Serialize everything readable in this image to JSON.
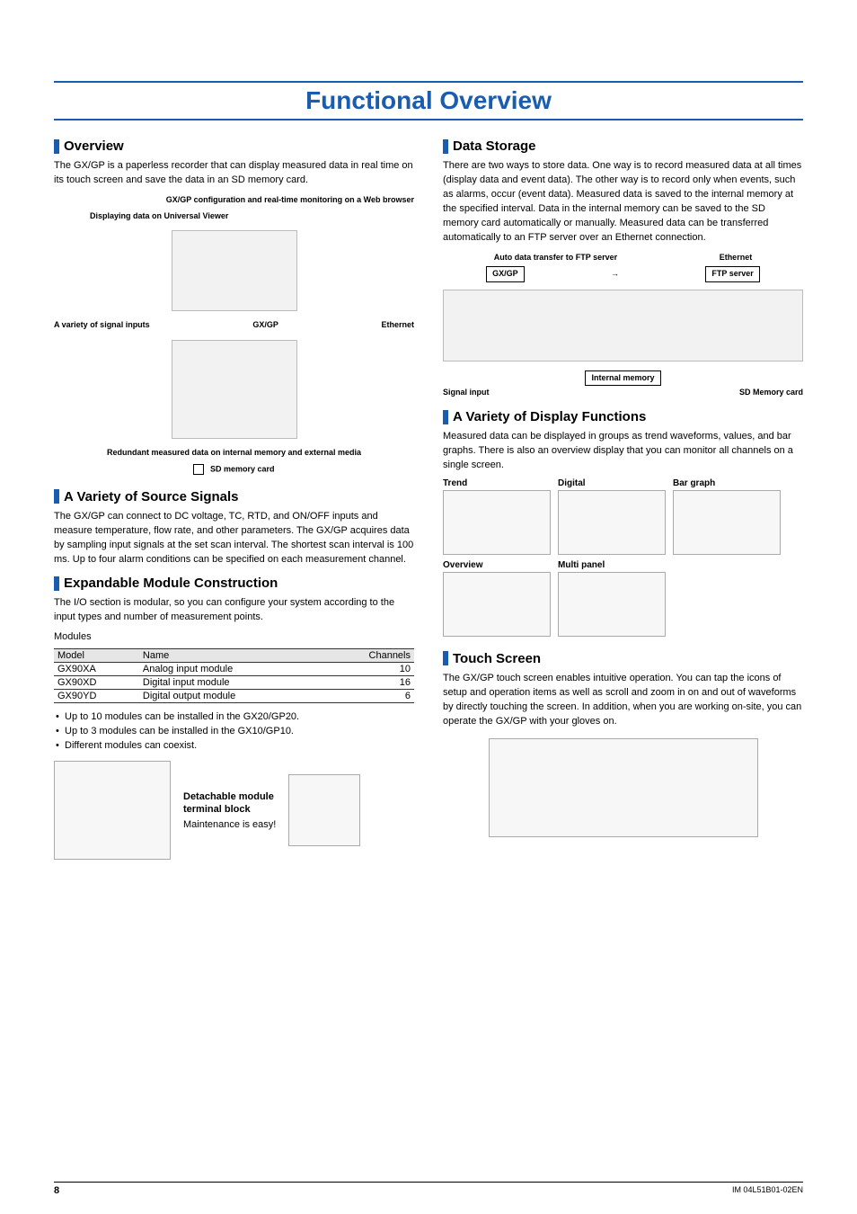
{
  "page_title": "Functional Overview",
  "left": {
    "overview": {
      "heading": "Overview",
      "text": "The GX/GP is a paperless recorder that can display measured data in real time on its touch screen and save the data in an SD memory card."
    },
    "overview_diagram": {
      "callout_config": "GX/GP configuration and real-time monitoring on a Web browser",
      "callout_viewer": "Displaying data on Universal Viewer",
      "label_ethernet": "Ethernet",
      "label_gxgp": "GX/GP",
      "callout_signals": "A variety of signal inputs",
      "callout_redundant": "Redundant measured data on internal memory and external media",
      "label_sd": "SD memory card"
    },
    "signals": {
      "heading": "A Variety of Source Signals",
      "text": "The GX/GP can connect to DC voltage, TC, RTD, and ON/OFF inputs and measure temperature, flow rate, and other parameters. The GX/GP acquires data by sampling input signals at the set scan interval. The shortest scan interval is 100 ms. Up to four alarm conditions can be specified on each measurement channel."
    },
    "modules": {
      "heading": "Expandable Module Construction",
      "text": "The I/O section is modular, so you can configure your system according to the input types and number of measurement points.",
      "table_caption": "Modules",
      "headers": {
        "c1": "Model",
        "c2": "Name",
        "c3": "Channels"
      },
      "rows": [
        {
          "model": "GX90XA",
          "name": "Analog input module",
          "channels": "10"
        },
        {
          "model": "GX90XD",
          "name": "Digital input module",
          "channels": "16"
        },
        {
          "model": "GX90YD",
          "name": "Digital output module",
          "channels": "6"
        }
      ],
      "bullets": [
        "Up to 10 modules can be installed in the GX20/GP20.",
        "Up to 3 modules can be installed in the GX10/GP10.",
        "Different modules can coexist."
      ],
      "fig": {
        "bold1": "Detachable module",
        "bold2": "terminal block",
        "plain": "Maintenance is easy!"
      }
    }
  },
  "right": {
    "storage": {
      "heading": "Data Storage",
      "text": "There are two ways to store data. One way is to record measured data at all times (display data and event data). The other way is to record only when events, such as alarms, occur (event data). Measured data is saved to the internal memory at the specified interval. Data in the internal memory can be saved to the SD memory card automatically or manually. Measured data can be transferred automatically to an FTP server over an Ethernet connection."
    },
    "storage_diagram": {
      "auto_transfer": "Auto data transfer to FTP server",
      "ethernet": "Ethernet",
      "gxgp": "GX/GP",
      "ftp": "FTP server",
      "internal": "Internal memory",
      "signal": "Signal input",
      "sd": "SD Memory card"
    },
    "display": {
      "heading": "A Variety of Display Functions",
      "text": "Measured data can be displayed in groups as trend waveforms, values, and bar graphs. There is also an overview display that you can monitor all channels on a single screen.",
      "items": {
        "trend": "Trend",
        "digital": "Digital",
        "bar": "Bar graph",
        "overview": "Overview",
        "multi": "Multi panel"
      }
    },
    "touch": {
      "heading": "Touch Screen",
      "text": "The GX/GP touch screen enables intuitive operation. You can tap the icons of setup and operation items as well as scroll and zoom in on and out of waveforms by directly touching the screen. In addition, when you are working on-site, you can operate the GX/GP with your gloves on."
    }
  },
  "footer": {
    "page": "8",
    "docid": "IM 04L51B01-02EN"
  }
}
